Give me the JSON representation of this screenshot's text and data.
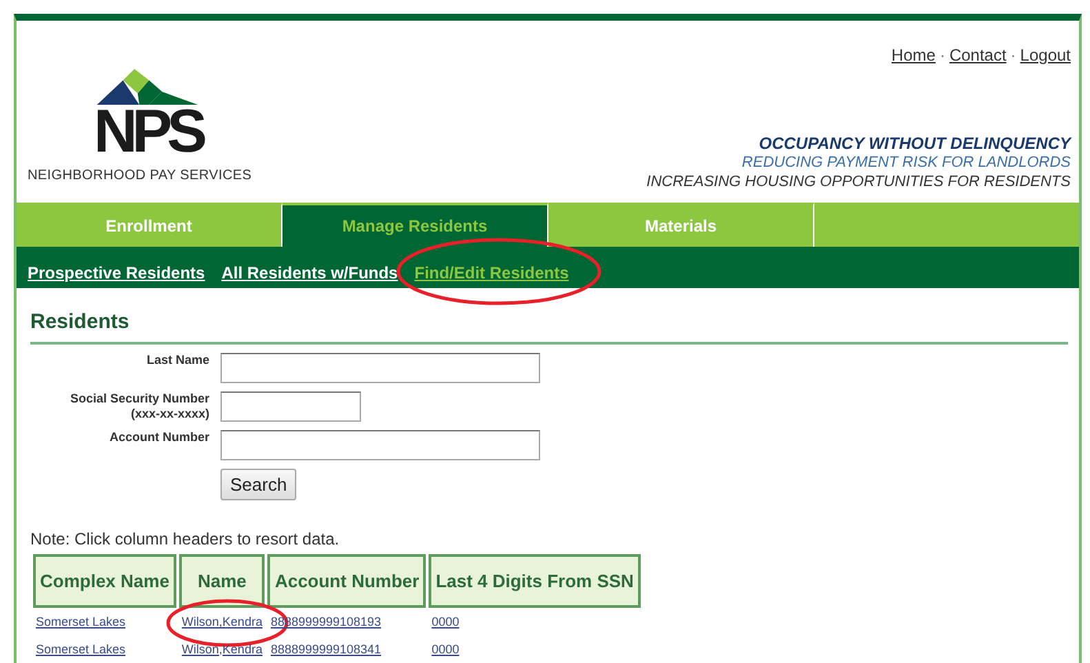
{
  "header": {
    "logo_text": "NPS",
    "company": "NEIGHBORHOOD PAY SERVICES",
    "top_links": [
      "Home",
      "Contact",
      "Logout"
    ],
    "link_separator": "·",
    "taglines": [
      {
        "text": "OCCUPANCY WITHOUT DELINQUENCY",
        "kind": "strong"
      },
      {
        "text": "REDUCING PAYMENT RISK FOR LANDLORDS",
        "kind": "accent"
      },
      {
        "text": "INCREASING HOUSING OPPORTUNITIES FOR RESIDENTS",
        "kind": "plain"
      }
    ]
  },
  "tabs": [
    {
      "label": "Enrollment",
      "selected": false
    },
    {
      "label": "Manage Residents",
      "selected": true
    },
    {
      "label": "Materials",
      "selected": false
    }
  ],
  "subnav": [
    {
      "label": "Prospective Residents",
      "selected": false,
      "circled": false
    },
    {
      "label": "All Residents w/Funds",
      "selected": false,
      "circled": false
    },
    {
      "label": "Find/Edit Residents",
      "selected": true,
      "circled": true
    }
  ],
  "section_title": "Residents",
  "form": {
    "fields": [
      {
        "label": "Last Name",
        "kind": "wide"
      },
      {
        "label": "Social Security Number",
        "hint": "(xxx-xx-xxxx)",
        "kind": "narrow"
      },
      {
        "label": "Account Number",
        "kind": "wide"
      }
    ],
    "button": "Search"
  },
  "note": "Note: Click column headers to resort data.",
  "table": {
    "columns": [
      "Complex Name",
      "Name",
      "Account Number",
      "Last 4 Digits From SSN"
    ],
    "rows": [
      {
        "cells": [
          "Somerset Lakes",
          "Wilson,Kendra",
          "8888999999108193",
          "0000"
        ],
        "circled": [
          false,
          true,
          false,
          false
        ]
      },
      {
        "cells": [
          "Somerset Lakes",
          "Wilson,Kendra",
          "8888999999108341",
          "0000"
        ],
        "circled": [
          false,
          false,
          false,
          false
        ]
      }
    ]
  }
}
